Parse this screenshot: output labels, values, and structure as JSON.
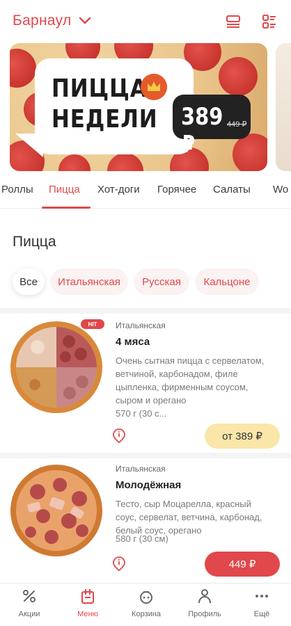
{
  "header": {
    "city": "Барнаул"
  },
  "banner": {
    "title_line1": "ПИЦЦА",
    "title_line2": "НЕДЕЛИ",
    "price": "389 ₽",
    "old_price": "449 ₽"
  },
  "tabs": [
    "Роллы",
    "Пицца",
    "Хот-доги",
    "Горячее",
    "Салаты",
    "Wo"
  ],
  "section": {
    "title": "Пицца"
  },
  "chips": [
    "Все",
    "Итальянская",
    "Русская",
    "Кальцоне"
  ],
  "products": [
    {
      "category": "Итальянская",
      "name": "4 мяса",
      "badge": "HIT",
      "description": [
        "Очень сытная пицца с сервелатом,",
        "ветчиной, карбонадом, филе",
        "цыпленка, фирменным соусом,",
        "сыром и орегано"
      ],
      "weight": "570 г (30 с...",
      "price_label": "от 389 ₽"
    },
    {
      "category": "Итальянская",
      "name": "Молодёжная",
      "description": [
        "Тесто, сыр Моцарелла, красный",
        "соус, сервелат, ветчина, карбонад,",
        "белый соус, орегано"
      ],
      "weight": "580 г (30 см)",
      "price_label": "449 ₽"
    }
  ],
  "nav": [
    {
      "label": "Акции",
      "icon": "percent-icon"
    },
    {
      "label": "Меню",
      "icon": "menu-icon"
    },
    {
      "label": "Корзина",
      "icon": "cart-icon"
    },
    {
      "label": "Профиль",
      "icon": "profile-icon"
    },
    {
      "label": "Ещё",
      "icon": "more-icon"
    }
  ],
  "colors": {
    "accent": "#e0484b",
    "from_button": "#f9e6a8"
  }
}
